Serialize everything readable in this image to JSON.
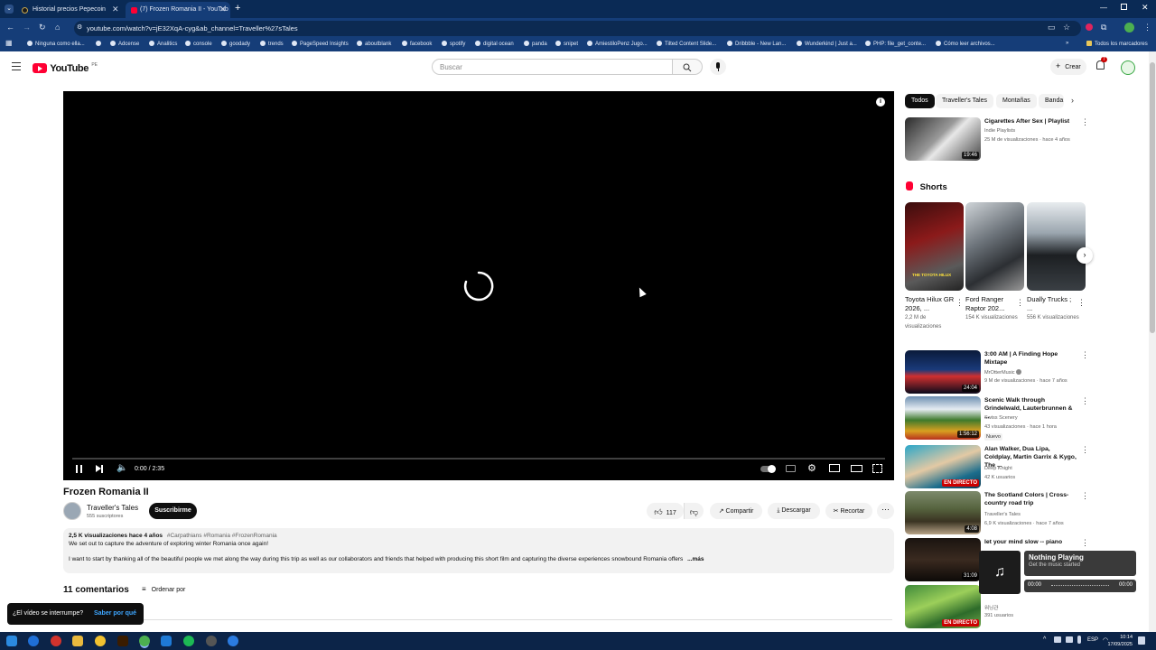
{
  "browser": {
    "tabs": [
      {
        "title": "Historial precios Pepecoin",
        "active": false
      },
      {
        "title": "(7) Frozen Romania II - YouTub",
        "active": true
      }
    ],
    "url": "youtube.com/watch?v=jE32XqA-cyg&ab_channel=Traveller%27sTales",
    "bookmarks": [
      "Ninguna como ella...",
      "Adcense",
      "Analitics",
      "console",
      "goodady",
      "trends",
      "PageSpeed Insights",
      "aboutblank",
      "facebook",
      "spotify",
      "digital ocean",
      "panda",
      "snipet",
      "AmiestiloPenz Jugo...",
      "Tilted Content Slide...",
      "Dribbble - New Lan...",
      "Wunderkind | Just a...",
      "PHP: file_get_conte...",
      "Cómo leer archivos..."
    ],
    "bookmarks_all": "Todos los marcadores"
  },
  "youtube": {
    "logo": "YouTube",
    "country": "PE",
    "search_placeholder": "Buscar",
    "create_label": "Crear",
    "notif_count": "7"
  },
  "player": {
    "time": "0:00 / 2:35"
  },
  "video": {
    "title": "Frozen Romania II",
    "channel": "Traveller's Tales",
    "subscribers": "555 suscriptores",
    "subscribe_label": "Suscribirme",
    "likes": "117",
    "share_label": "Compartir",
    "download_label": "Descargar",
    "clip_label": "Recortar",
    "views_date": "2,5 K visualizaciones  hace 4 años",
    "hashtags": "#Carpathians #Romania #FrozenRomania",
    "desc_line1": "We set out to capture the adventure of exploring winter Romania once again!",
    "desc_line2": "I want to start by thanking all of the beautiful people we met along the way during this trip as well as our collaborators and friends that helped with producing this short film and capturing the diverse experiences snowbound Romania offers",
    "desc_more": "...más",
    "comments_count": "11 comentarios",
    "sort_label": "Ordenar por"
  },
  "chips": [
    "Todos",
    "Traveller's Tales",
    "Montañas",
    "Banda"
  ],
  "sidebar_top": {
    "title": "Cigarettes After Sex | Playlist",
    "channel": "Indie Playlists",
    "meta": "25 M de visualizaciones · hace 4 años",
    "duration": "19:46"
  },
  "shorts": {
    "heading": "Shorts",
    "items": [
      {
        "title": "Toyota Hilux GR 2026, ...",
        "views": "2,2 M de visualizaciones",
        "overlay": "THE TOYOTA HILUX"
      },
      {
        "title": "Ford Ranger Raptor 202...",
        "views": "154 K visualizaciones",
        "overlay": ""
      },
      {
        "title": "Dually Trucks ; ...",
        "views": "556 K visualizaciones",
        "overlay": ""
      }
    ]
  },
  "related": [
    {
      "title": "3:00 AM | A Finding Hope Mixtape",
      "channel": "MrOtterMusic",
      "meta": "9 M de visualizaciones · hace 7 años",
      "duration": "24:04",
      "badge": ""
    },
    {
      "title": "Scenic Walk through Grindelwald, Lauterbrunnen & ...",
      "channel": "Swiss Scenery",
      "meta": "43 visualizaciones · hace 1 hora",
      "duration": "1:56:12",
      "badge": "Nuevo"
    },
    {
      "title": "Alan Walker, Dua Lipa, Coldplay, Martin Garrix & Kygo, The ...",
      "channel": "Deep Knight",
      "meta": "42 K usuarios",
      "duration": "EN DIRECTO",
      "badge": ""
    },
    {
      "title": "The Scotland Colors | Cross-country road trip",
      "channel": "Traveller's Tales",
      "meta": "6,9 K visualizaciones · hace 7 años",
      "duration": "4:08",
      "badge": ""
    },
    {
      "title": "let your mind slow -- piano",
      "channel": "",
      "meta": "",
      "duration": "31:09",
      "badge": ""
    },
    {
      "title": "",
      "channel": "워닝관",
      "meta": "391 usuarios",
      "duration": "EN DIRECTO",
      "badge": ""
    }
  ],
  "miniplayer": {
    "title": "Nothing Playing",
    "subtitle": "Get the music started",
    "time_start": "00:00",
    "time_end": "00:00"
  },
  "toast": {
    "question": "¿El vídeo se interrumpe?",
    "link": "Saber por qué"
  },
  "taskbar": {
    "lang": "ESP",
    "time": "10:14",
    "date": "17/09/2025"
  }
}
